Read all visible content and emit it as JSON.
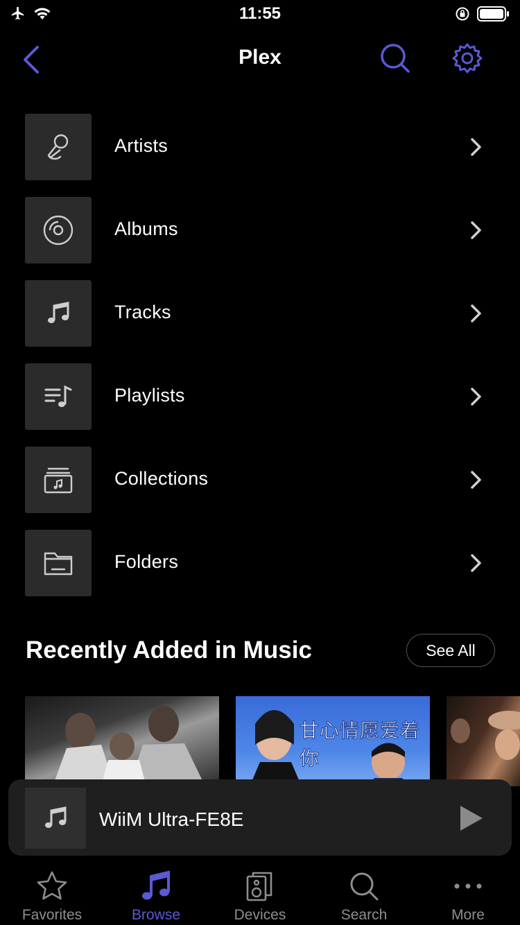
{
  "status_bar": {
    "time": "11:55"
  },
  "nav": {
    "title": "Plex"
  },
  "menu": {
    "items": [
      {
        "label": "Artists",
        "icon": "microphone-icon"
      },
      {
        "label": "Albums",
        "icon": "disc-icon"
      },
      {
        "label": "Tracks",
        "icon": "music-note-icon"
      },
      {
        "label": "Playlists",
        "icon": "playlist-icon"
      },
      {
        "label": "Collections",
        "icon": "collection-icon"
      },
      {
        "label": "Folders",
        "icon": "folder-icon"
      }
    ]
  },
  "recently_added": {
    "title": "Recently Added in Music",
    "see_all_label": "See All",
    "album_2_art_text": "甘心情愿爱着你"
  },
  "mini_player": {
    "device_name": "WiiM Ultra-FE8E"
  },
  "tabbar": {
    "tabs": [
      {
        "label": "Favorites",
        "icon": "star-icon"
      },
      {
        "label": "Browse",
        "icon": "music-note-icon",
        "active": true
      },
      {
        "label": "Devices",
        "icon": "speaker-icon"
      },
      {
        "label": "Search",
        "icon": "search-icon"
      },
      {
        "label": "More",
        "icon": "more-icon"
      }
    ]
  },
  "colors": {
    "accent": "#5a5ad6",
    "background": "#000000",
    "tile": "#2b2b2b",
    "inactive": "#8e8e8e"
  }
}
